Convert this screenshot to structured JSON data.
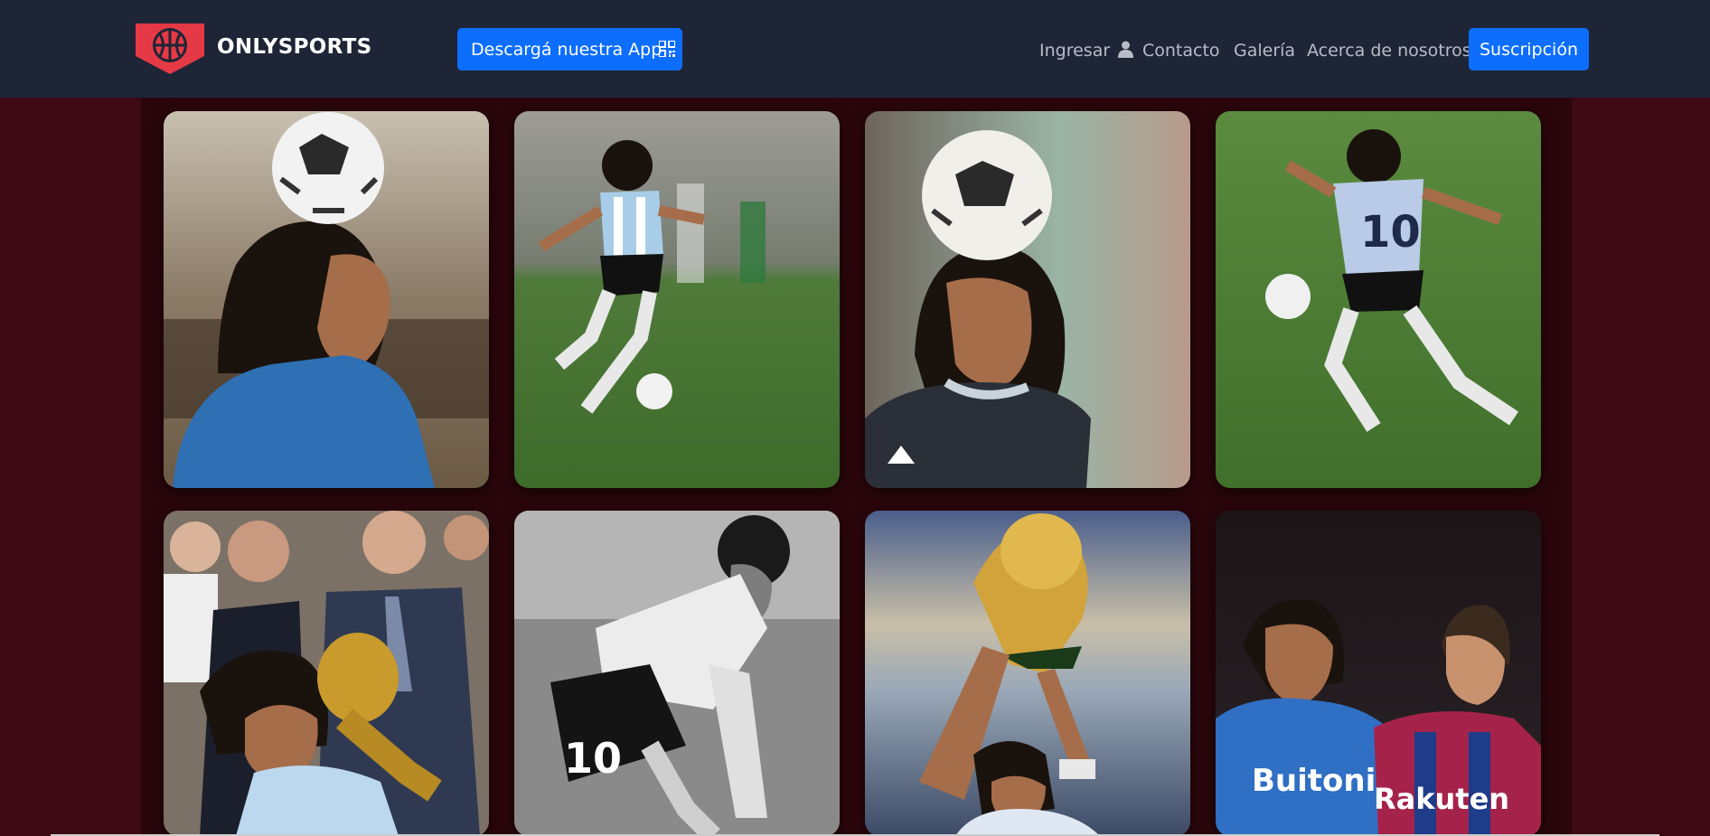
{
  "navbar": {
    "brand_name": "ONLYSPORTS",
    "app_button_label": "Descargá nuestra App",
    "app_button_icon": "qr-code-icon",
    "links": {
      "login": "Ingresar",
      "contact": "Contacto",
      "gallery": "Galería",
      "about": "Acerca de nosotros"
    },
    "login_icon": "user-icon",
    "subscribe_label": "Suscripción"
  },
  "colors": {
    "navbar_bg": "#1e2536",
    "page_bg": "#3d0a13",
    "content_bg": "#2a060b",
    "accent": "#0d6efd",
    "logo_red": "#e63946"
  },
  "gallery": {
    "photos": [
      {
        "subject": "player-heading-ball-blue-shirt"
      },
      {
        "subject": "player-dribbling-argentina-kit"
      },
      {
        "subject": "player-ball-on-head-dark-shirt"
      },
      {
        "subject": "player-number-10-running"
      },
      {
        "subject": "player-kissing-world-cup-trophy"
      },
      {
        "subject": "player-black-and-white-number-10"
      },
      {
        "subject": "player-lifting-world-cup-trophy"
      },
      {
        "subject": "two-players-buitoni-rakuten-shirts"
      }
    ]
  }
}
